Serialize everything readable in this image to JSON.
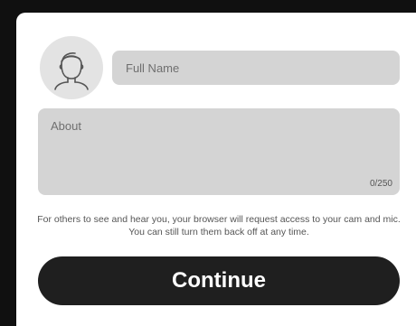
{
  "profile": {
    "avatar_icon": "user-avatar-icon"
  },
  "full_name": {
    "placeholder": "Full Name",
    "value": ""
  },
  "about": {
    "placeholder": "About",
    "value": "",
    "counter": "0/250"
  },
  "notice": "For others to see and hear you, your browser will request access to your cam and mic. You can still turn them back off at any time.",
  "continue_label": "Continue",
  "colors": {
    "field_background": "#d4d4d4",
    "button_background": "#1f1f1f",
    "avatar_background": "#e3e3e3"
  }
}
